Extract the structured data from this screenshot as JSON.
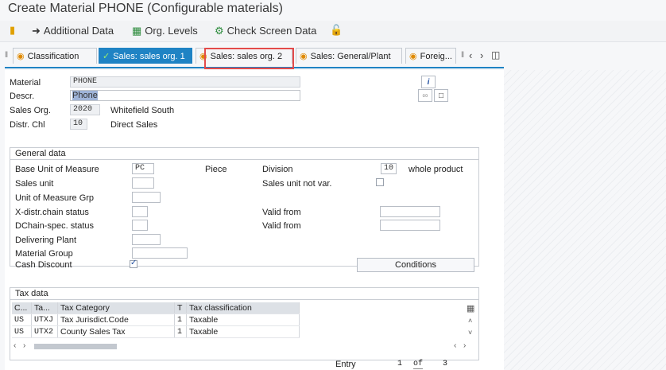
{
  "window": {
    "title": "Create Material PHONE (Configurable materials)"
  },
  "toolbar": {
    "additional_data": "Additional Data",
    "org_levels": "Org. Levels",
    "check_screen_data": "Check Screen Data"
  },
  "tabs": [
    {
      "label": "Classification"
    },
    {
      "label": "Sales: sales org. 1"
    },
    {
      "label": "Sales: sales org. 2"
    },
    {
      "label": "Sales: General/Plant"
    },
    {
      "label": "Foreig..."
    }
  ],
  "header": {
    "material_label": "Material",
    "material_value": "PHONE",
    "descr_label": "Descr.",
    "descr_value": "Phone",
    "sales_org_label": "Sales Org.",
    "sales_org_value": "2020",
    "sales_org_text": "Whitefield South",
    "distr_chl_label": "Distr. Chl",
    "distr_chl_value": "10",
    "distr_chl_text": "Direct Sales"
  },
  "general": {
    "title": "General data",
    "base_uom_label": "Base Unit of Measure",
    "base_uom_value": "PC",
    "base_uom_text": "Piece",
    "division_label": "Division",
    "division_value": "10",
    "division_text": "whole product",
    "sales_unit_label": "Sales unit",
    "sales_unit_not_var_label": "Sales unit not var.",
    "uom_grp_label": "Unit of Measure Grp",
    "xdistr_label": "X-distr.chain status",
    "valid_from_1_label": "Valid from",
    "dchain_label": "DChain-spec. status",
    "valid_from_2_label": "Valid from",
    "delivering_plant_label": "Delivering Plant",
    "material_group_label": "Material Group",
    "cash_discount_label": "Cash Discount",
    "cash_discount_checked": true,
    "conditions_label": "Conditions"
  },
  "tax": {
    "title": "Tax data",
    "columns": [
      "C...",
      "Ta...",
      "Tax Category",
      "T",
      "Tax classification"
    ],
    "rows": [
      {
        "country": "US",
        "tax_type": "UTXJ",
        "category": "Tax Jurisdict.Code",
        "t": "1",
        "classification": "Taxable"
      },
      {
        "country": "US",
        "tax_type": "UTX2",
        "category": "County Sales Tax",
        "t": "1",
        "classification": "Taxable"
      }
    ],
    "entry_label": "Entry",
    "entry_current": "1",
    "entry_of": "of",
    "entry_total": "3"
  }
}
